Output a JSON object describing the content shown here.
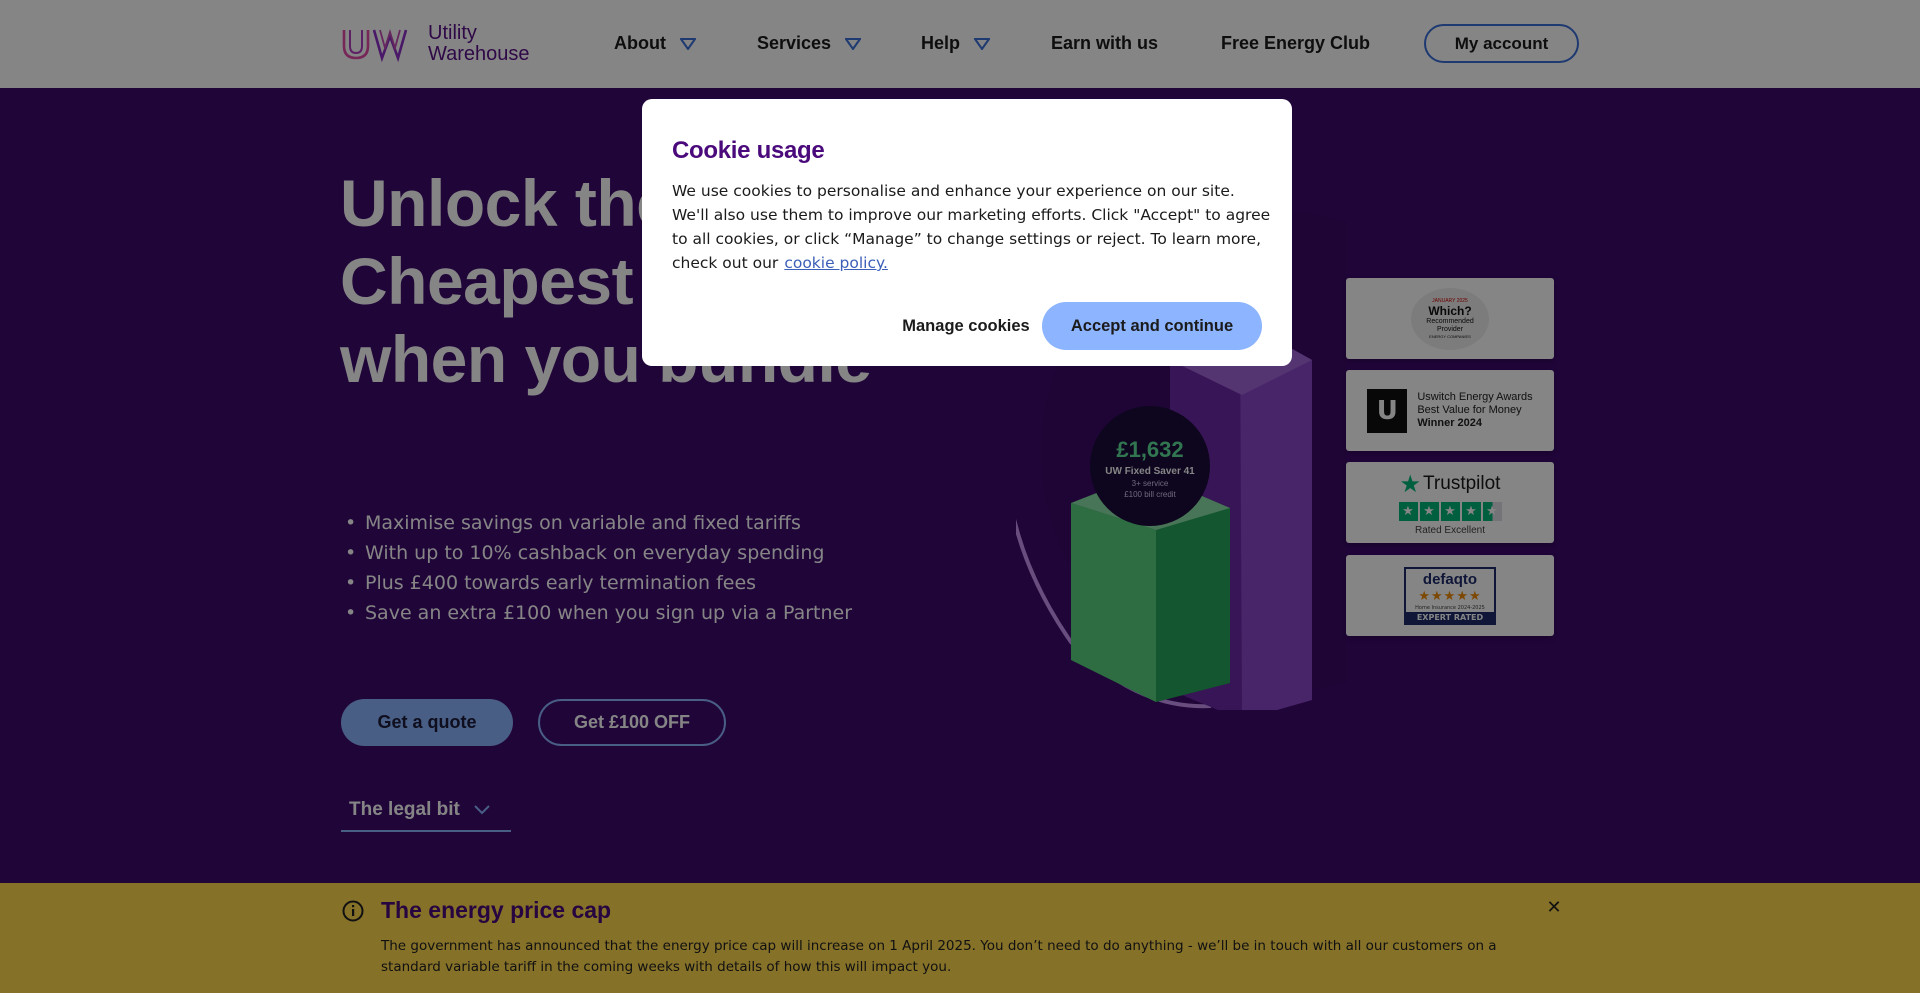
{
  "header": {
    "logo_text_line1": "Utility",
    "logo_text_line2": "Warehouse",
    "nav": [
      {
        "label": "About",
        "dropdown": true
      },
      {
        "label": "Services",
        "dropdown": true
      },
      {
        "label": "Help",
        "dropdown": true
      },
      {
        "label": "Earn with us",
        "dropdown": false
      },
      {
        "label": "Free Energy Club",
        "dropdown": false
      }
    ],
    "account_label": "My account"
  },
  "hero": {
    "title": "Unlock the Cheapest Energy when you bundle",
    "bullets": [
      "Maximise savings on variable and fixed tariffs",
      "With up to 10% cashback on everyday spending",
      "Plus £400 towards early termination fees",
      "Save an extra £100 when you sign up via a Partner"
    ],
    "quote_label": "Get a quote",
    "offer_label": "Get £100 OFF",
    "legal_label": "The legal bit",
    "price_bubble": {
      "amount": "£1,632",
      "tariff": "UW Fixed Saver 41",
      "line1": "3+ service",
      "line2": "£100 bill credit"
    }
  },
  "badges": {
    "which": {
      "top": "JANUARY 2025",
      "name": "Which?",
      "line1": "Recommended",
      "line2": "Provider",
      "bottom": "ENERGY COMPANIES"
    },
    "uswitch": {
      "logo": "U",
      "line1": "Uswitch Energy Awards",
      "line2": "Best Value for Money",
      "line3": "Winner 2024"
    },
    "trustpilot": {
      "name": "Trustpilot",
      "rating": "Rated Excellent",
      "stars": 4.5
    },
    "defaqto": {
      "name": "defaqto",
      "sub": "Home Insurance 2024-2025",
      "foot": "EXPERT RATED",
      "stars": 5
    }
  },
  "price_cap": {
    "title": "The energy price cap",
    "text": "The government has announced that the energy price cap will increase on 1 April 2025. You don’t need to do anything - we’ll be in touch with all our customers on a standard variable tariff in the coming weeks with details of how this will impact you.",
    "close_icon": "close-icon"
  },
  "cookie_modal": {
    "title": "Cookie usage",
    "text": "We use cookies to personalise and enhance your experience on our site. We'll also use them to improve our marketing efforts. Click \"Accept\" to agree to all cookies, or click “Manage” to change settings or reject. To learn more, check out our",
    "link_label": "cookie policy.",
    "manage_label": "Manage cookies",
    "accept_label": "Accept and continue"
  },
  "colors": {
    "brand_purple": "#4a0a7c",
    "hero_bg": "#3e0a6e",
    "accent_blue": "#8cb4ff",
    "banner_yellow": "#ffd84d",
    "green": "#2fa35a"
  }
}
